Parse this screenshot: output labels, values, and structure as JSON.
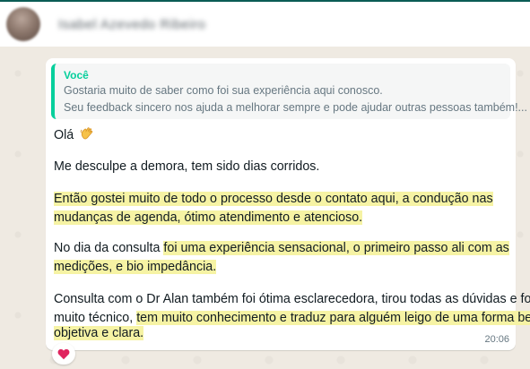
{
  "header": {
    "contact_name": "Isabel Azevedo Ribeiro"
  },
  "message": {
    "quote": {
      "author": "Você",
      "lines": [
        "Gostaria muito de saber como foi sua experiência aqui conosco.",
        "Seu feedback sincero nos ajuda a melhorar sempre e pode ajudar outras pessoas também!..."
      ]
    },
    "greeting": "Olá",
    "apology": "Me desculpe a demora, tem sido dias corridos.",
    "p1_line1": "Então gostei muito de todo o processo desde o contato aqui, a condução nas",
    "p1_line2": "mudanças de agenda, ótimo atendimento e atencioso.",
    "p2_line1_plain": "No dia da consulta ",
    "p2_line1_hl": "foi uma experiência sensacional, o primeiro passo ali com as",
    "p2_line2": "medições, e bio impedância.",
    "p3_line1": "Consulta com o Dr Alan também foi ótima esclarecedora, tirou todas as dúvidas e foi",
    "p3_line2_plain": "muito técnico, ",
    "p3_line2_hl": "tem muito conhecimento e traduz para alguém leigo de uma forma bem",
    "p3_line3": "objetiva e clara.",
    "time": "20:06"
  },
  "icons": {
    "greeting_emoji": "waving-hand-icon",
    "reaction": "heart-icon"
  },
  "colors": {
    "accent": "#06cf9c",
    "highlight": "#f6f3a4",
    "chat_background": "#efeae2",
    "bubble": "#ffffff"
  }
}
